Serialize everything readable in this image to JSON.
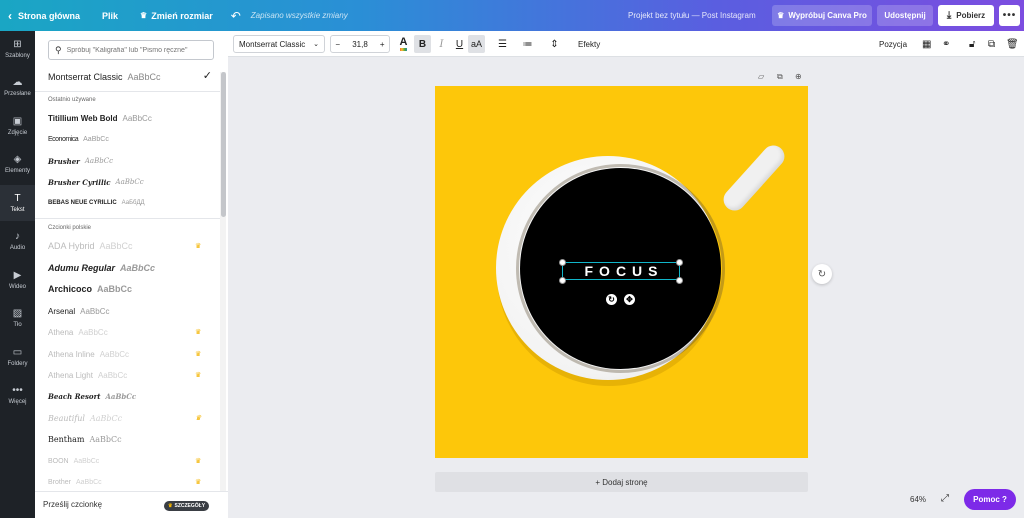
{
  "topbar": {
    "home_label": "Strona główna",
    "file_label": "Plik",
    "resize_label": "Zmień rozmiar",
    "saved_status": "Zapisano wszystkie zmiany",
    "project_title": "Projekt bez tytułu — Post Instagram",
    "try_pro_label": "Wypróbuj Canva Pro",
    "share_label": "Udostępnij",
    "download_label": "Pobierz",
    "more_label": "•••"
  },
  "leftnav": {
    "items": [
      {
        "label": "Szablony",
        "icon": "⊞"
      },
      {
        "label": "Przesłane",
        "icon": "☁"
      },
      {
        "label": "Zdjęcie",
        "icon": "▣"
      },
      {
        "label": "Elementy",
        "icon": "◈"
      },
      {
        "label": "Tekst",
        "icon": "T"
      },
      {
        "label": "Audio",
        "icon": "♪"
      },
      {
        "label": "Wideo",
        "icon": "▶"
      },
      {
        "label": "Tło",
        "icon": "▨"
      },
      {
        "label": "Foldery",
        "icon": "▭"
      },
      {
        "label": "Więcej",
        "icon": "•••"
      }
    ]
  },
  "fontpanel": {
    "search_placeholder": "Spróbuj \"Kaligrafia\" lub \"Pismo ręczne\"",
    "selected_font": {
      "name": "Montserrat Classic",
      "sample": "AaBbCc"
    },
    "recent_label": "Ostatnio używane",
    "recent": [
      {
        "name": "Titillium Web Bold",
        "sample": "AaBbCc"
      },
      {
        "name": "Economica",
        "sample": "AaBbCc"
      },
      {
        "name": "Brusher",
        "sample": "AaBbCc"
      },
      {
        "name": "Brusher Cyrillic",
        "sample": "AaBbCc"
      },
      {
        "name": "BEBAS NEUE CYRILLIC",
        "sample": "АаБбДД"
      }
    ],
    "polish_label": "Czcionki polskie",
    "polish": [
      {
        "name": "ADA Hybrid",
        "sample": "AaBbCc",
        "pro": true,
        "dim": true
      },
      {
        "name": "Adumu Regular",
        "sample": "AaBbCc",
        "pro": false,
        "dim": false
      },
      {
        "name": "Archicoco",
        "sample": "AaBbCc",
        "pro": false,
        "dim": false
      },
      {
        "name": "Arsenal",
        "sample": "AaBbCc",
        "pro": false,
        "dim": false
      },
      {
        "name": "Athena",
        "sample": "AaBbCc",
        "pro": true,
        "dim": true
      },
      {
        "name": "Athena Inline",
        "sample": "AaBbCc",
        "pro": true,
        "dim": true
      },
      {
        "name": "Athena Light",
        "sample": "AaBbCc",
        "pro": true,
        "dim": true
      },
      {
        "name": "Beach Resort",
        "sample": "AaBbCc",
        "pro": false,
        "dim": false
      },
      {
        "name": "Beautiful",
        "sample": "AaBbCc",
        "pro": true,
        "dim": true
      },
      {
        "name": "Bentham",
        "sample": "AaBbCc",
        "pro": false,
        "dim": false
      },
      {
        "name": "BOON",
        "sample": "AaBbCc",
        "pro": true,
        "dim": true
      },
      {
        "name": "Brother",
        "sample": "AaBbCc",
        "pro": true,
        "dim": true
      }
    ],
    "upload_label": "Prześlij czcionkę",
    "details_badge": "SZCZEGÓŁY"
  },
  "toolbar": {
    "font_name": "Montserrat Classic",
    "minus": "−",
    "font_size": "31,8",
    "plus": "+",
    "effects_label": "Efekty",
    "position_label": "Pozycja"
  },
  "canvas": {
    "text": "FOCUS",
    "add_page_label": "+ Dodaj stronę",
    "zoom": "64%",
    "help_label": "Pomoc ?"
  },
  "colors": {
    "topbar_start": "#1aa6c4",
    "topbar_end": "#7c4de0",
    "background_yellow": "#fdc70a",
    "selection": "#11b5c9",
    "help_purple": "#7d2ae8"
  }
}
